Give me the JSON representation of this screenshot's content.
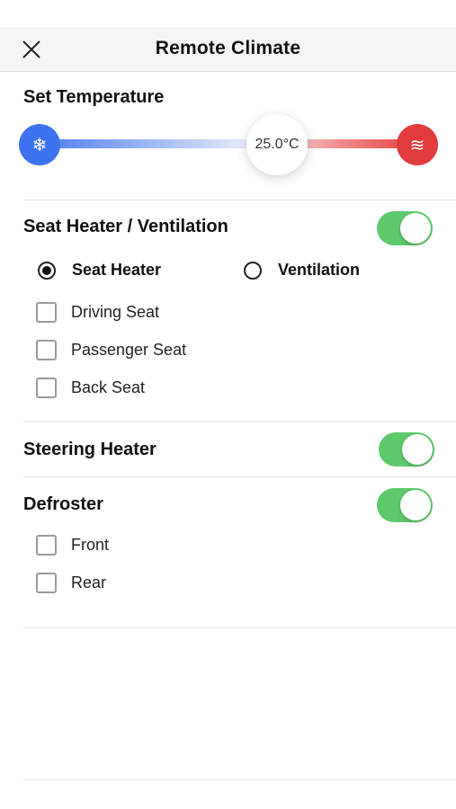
{
  "header": {
    "title": "Remote Climate",
    "close_icon": "close-icon"
  },
  "temperature": {
    "title": "Set Temperature",
    "value_text": "25.0°C",
    "value": 25.0,
    "cold_icon": "❄",
    "hot_icon": "≋"
  },
  "seat": {
    "title": "Seat Heater / Ventilation",
    "enabled": true,
    "modes": [
      {
        "label": "Seat Heater",
        "selected": true
      },
      {
        "label": "Ventilation",
        "selected": false
      }
    ],
    "seats": [
      {
        "label": "Driving Seat",
        "checked": false
      },
      {
        "label": "Passenger Seat",
        "checked": false
      },
      {
        "label": "Back Seat",
        "checked": false
      }
    ]
  },
  "steering": {
    "title": "Steering Heater",
    "enabled": true
  },
  "defroster": {
    "title": "Defroster",
    "enabled": true,
    "options": [
      {
        "label": "Front",
        "checked": false
      },
      {
        "label": "Rear",
        "checked": false
      }
    ]
  },
  "colors": {
    "toggle_on": "#5ec96a",
    "cold": "#3d73ee",
    "hot": "#e23b3b"
  }
}
